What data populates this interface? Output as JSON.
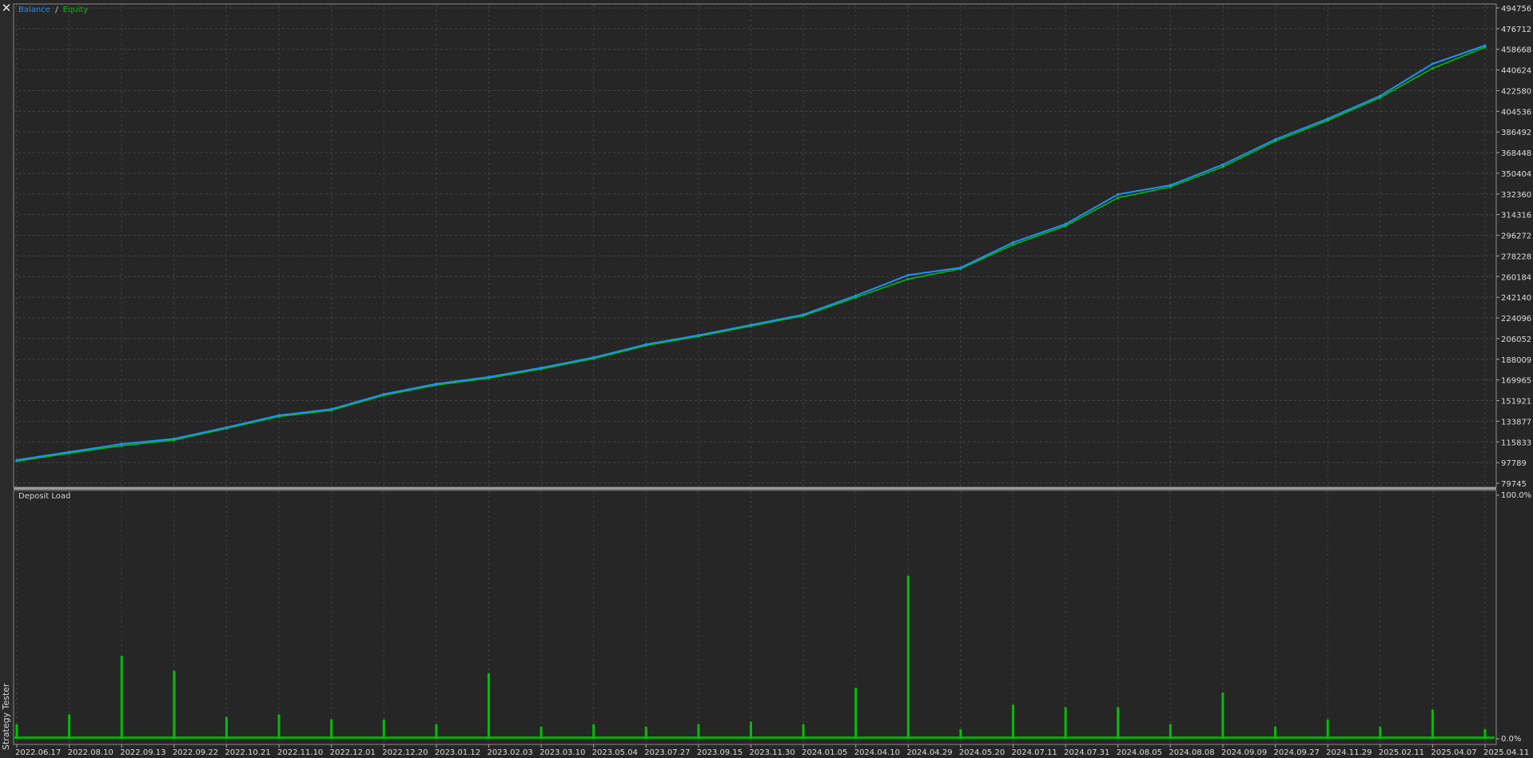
{
  "window": {
    "side_title": "Strategy Tester"
  },
  "main_chart": {
    "legend": {
      "balance_label": "Balance",
      "separator": "/",
      "equity_label": "Equity"
    },
    "y_ticks": [
      "494756",
      "476712",
      "458668",
      "440624",
      "422580",
      "404536",
      "386492",
      "368448",
      "350404",
      "332360",
      "314316",
      "296272",
      "278228",
      "260184",
      "242140",
      "224096",
      "206052",
      "188009",
      "169965",
      "151921",
      "133877",
      "115833",
      "97789",
      "79745"
    ],
    "colors": {
      "balance": "#1e90ff",
      "equity": "#00c000",
      "background": "#262626",
      "grid": "#4a4a4a"
    }
  },
  "sub_chart": {
    "title": "Deposit Load",
    "y_ticks": [
      "100.0%",
      "0.0%"
    ]
  },
  "x_ticks": [
    "2022.06.17",
    "2022.08.10",
    "2022.09.13",
    "2022.09.22",
    "2022.10.21",
    "2022.11.10",
    "2022.12.01",
    "2022.12.20",
    "2023.01.12",
    "2023.02.03",
    "2023.03.10",
    "2023.05.04",
    "2023.07.27",
    "2023.09.15",
    "2023.11.30",
    "2024.01.05",
    "2024.04.10",
    "2024.04.29",
    "2024.05.20",
    "2024.07.11",
    "2024.07.31",
    "2024.08.05",
    "2024.08.08",
    "2024.09.09",
    "2024.09.27",
    "2024.11.29",
    "2025.02.11",
    "2025.04.07",
    "2025.04.11"
  ],
  "chart_data": [
    {
      "type": "line",
      "title": "",
      "legend": [
        "Balance",
        "Equity"
      ],
      "x": [
        "2022.06.17",
        "2022.08.10",
        "2022.09.13",
        "2022.09.22",
        "2022.10.21",
        "2022.11.10",
        "2022.12.01",
        "2022.12.20",
        "2023.01.12",
        "2023.02.03",
        "2023.03.10",
        "2023.05.04",
        "2023.07.27",
        "2023.09.15",
        "2023.11.30",
        "2024.01.05",
        "2024.04.10",
        "2024.04.29",
        "2024.05.20",
        "2024.07.11",
        "2024.07.31",
        "2024.08.05",
        "2024.08.08",
        "2024.09.09",
        "2024.09.27",
        "2024.11.29",
        "2025.02.11",
        "2025.04.07",
        "2025.04.11"
      ],
      "ylim": [
        79745,
        494756
      ],
      "series": [
        {
          "name": "Balance",
          "values": [
            100000,
            107000,
            114000,
            118500,
            128500,
            139000,
            144500,
            157500,
            166500,
            172500,
            180500,
            189500,
            201000,
            209000,
            218000,
            227000,
            243500,
            261500,
            268000,
            290000,
            306000,
            332000,
            340000,
            358000,
            380000,
            398000,
            418000,
            446000,
            462000
          ]
        },
        {
          "name": "Equity",
          "values": [
            99000,
            106000,
            112500,
            117500,
            127500,
            138000,
            143500,
            156500,
            165500,
            171500,
            179500,
            188500,
            200000,
            208000,
            217000,
            226000,
            242000,
            258000,
            267000,
            288000,
            304500,
            329000,
            338500,
            356000,
            378500,
            396500,
            416500,
            442000,
            460500
          ]
        }
      ]
    },
    {
      "type": "bar",
      "title": "Deposit Load",
      "ylim": [
        0,
        100
      ],
      "unit": "%",
      "categories": [
        "2022.06.17",
        "2022.08.10",
        "2022.09.13",
        "2022.09.22",
        "2022.10.21",
        "2022.11.10",
        "2022.12.01",
        "2022.12.20",
        "2023.01.12",
        "2023.02.03",
        "2023.03.10",
        "2023.05.04",
        "2023.07.27",
        "2023.09.15",
        "2023.11.30",
        "2024.01.05",
        "2024.04.10",
        "2024.04.29",
        "2024.05.20",
        "2024.07.11",
        "2024.07.31",
        "2024.08.05",
        "2024.08.08",
        "2024.09.09",
        "2024.09.27",
        "2024.11.29",
        "2025.02.11",
        "2025.04.07",
        "2025.04.11"
      ],
      "values": [
        6,
        10,
        34,
        28,
        9,
        10,
        8,
        8,
        6,
        27,
        5,
        6,
        5,
        6,
        7,
        6,
        21,
        67,
        4,
        14,
        13,
        13,
        6,
        19,
        5,
        8,
        5,
        12,
        4
      ]
    }
  ]
}
